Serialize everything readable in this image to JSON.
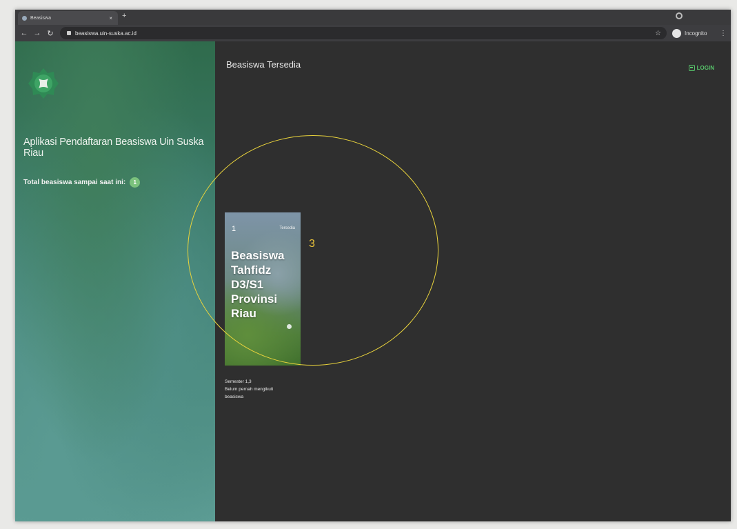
{
  "browser": {
    "tab_title": "Beasiswa",
    "tab_close": "×",
    "new_tab": "+",
    "url": "beasiswa.uin-suska.ac.id",
    "incognito_label": "Incognito"
  },
  "sidebar": {
    "app_title": "Aplikasi Pendaftaran Beasiswa Uin Suska Riau",
    "total_label": "Total beasiswa sampai saat ini:",
    "total_count": "1"
  },
  "main": {
    "title": "Beasiswa Tersedia",
    "login_label": "LOGIN",
    "cards": [
      {
        "number": "1",
        "status": "Tersedia",
        "title": "Beasiswa Tahfidz D3/S1 Provinsi Riau",
        "info": [
          "Semester 1,3",
          "Belum pernah mengikuti",
          "beasiswa"
        ]
      }
    ]
  },
  "annotation": {
    "label": "3"
  },
  "colors": {
    "accent": "#57c46a",
    "annotation": "#e8d23c",
    "background": "#2f2f2f"
  }
}
